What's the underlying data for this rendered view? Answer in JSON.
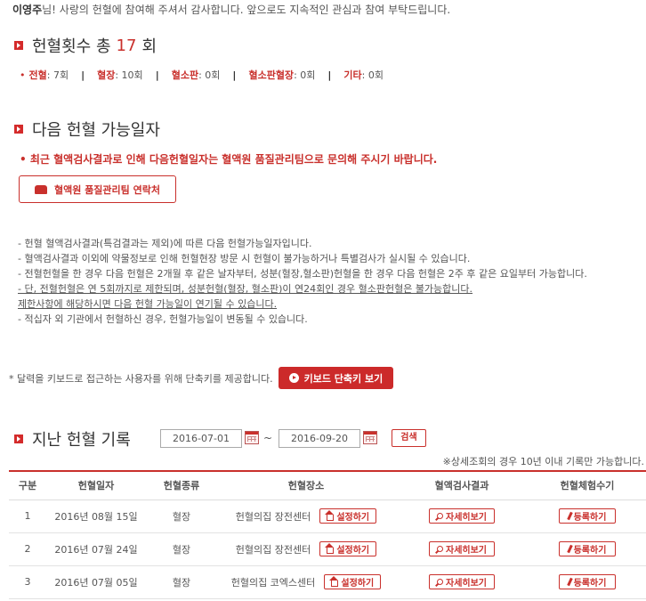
{
  "greeting": {
    "name": "이영주",
    "message": "님! 사랑의 헌혈에 참여해 주셔서 감사합니다. 앞으로도 지속적인 관심과 참여 부탁드립니다."
  },
  "total": {
    "prefix": "헌혈횟수 총",
    "count": "17",
    "suffix": "회"
  },
  "summary": [
    {
      "label": "전혈",
      "value": ": 7회"
    },
    {
      "label": "혈장",
      "value": ": 10회"
    },
    {
      "label": "혈소판",
      "value": ": 0회"
    },
    {
      "label": "혈소판혈장",
      "value": ": 0회"
    },
    {
      "label": "기타",
      "value": ": 0회"
    }
  ],
  "next": {
    "title": "다음 헌혈 가능일자",
    "notice": "최근 혈액검사결과로 인해 다음헌혈일자는 혈액원 품질관리팀으로 문의해 주시기 바랍니다.",
    "contact_button": "혈액원 품질관리팀 연락처"
  },
  "info_lines": [
    "- 헌혈 혈액검사결과(특검결과는 제외)에 따른 다음 헌혈가능일자입니다.",
    "- 혈액검사결과 이외에 약물정보로 인해 헌혈현장 방문 시 헌혈이 불가능하거나 특별검사가 실시될 수 있습니다.",
    "- 전혈헌혈을 한 경우 다음 헌혈은 2개월 후 같은 날자부터, 성분(혈장,혈소판)헌혈을 한 경우 다음 헌혈은 2주 후 같은 요일부터 가능합니다.",
    "- 단, 전혈헌혈은 연 5회까지로 제한되며, 성분헌혈(혈장, 혈소판)이 연24회인 경우 혈소판헌혈은 불가능합니다.",
    "제한사항에 해당하시면 다음 헌혈 가능일이 연기될 수 있습니다.",
    "- 적십자 외 기관에서 헌혈하신 경우, 헌혈가능일이 변동될 수 있습니다."
  ],
  "keyboard": {
    "text": "* 달력을 키보드로 접근하는 사용자를 위해 단축키를 제공합니다.",
    "button": "키보드 단축키 보기"
  },
  "history": {
    "title": "지난 헌혈 기록",
    "date_from": "2016-07-01",
    "tilde": "~",
    "date_to": "2016-09-20",
    "search": "검색",
    "note": "※상세조회의 경우 10년 이내 기록만 가능합니다.",
    "headers": [
      "구분",
      "헌혈일자",
      "헌혈종류",
      "헌혈장소",
      "혈액검사결과",
      "헌혈체험수기"
    ],
    "rows": [
      {
        "no": "1",
        "date": "2016년 08월 15일",
        "type": "혈장",
        "place": "헌혈의집 장전센터",
        "set": "설정하기",
        "detail": "자세히보기",
        "reg": "등록하기"
      },
      {
        "no": "2",
        "date": "2016년 07월 24일",
        "type": "혈장",
        "place": "헌혈의집 장전센터",
        "set": "설정하기",
        "detail": "자세히보기",
        "reg": "등록하기"
      },
      {
        "no": "3",
        "date": "2016년 07월 05일",
        "type": "혈장",
        "place": "헌혈의집 코엑스센터",
        "set": "설정하기",
        "detail": "자세히보기",
        "reg": "등록하기"
      }
    ]
  },
  "colors": {
    "accent": "#c9302c",
    "text": "#555555"
  }
}
